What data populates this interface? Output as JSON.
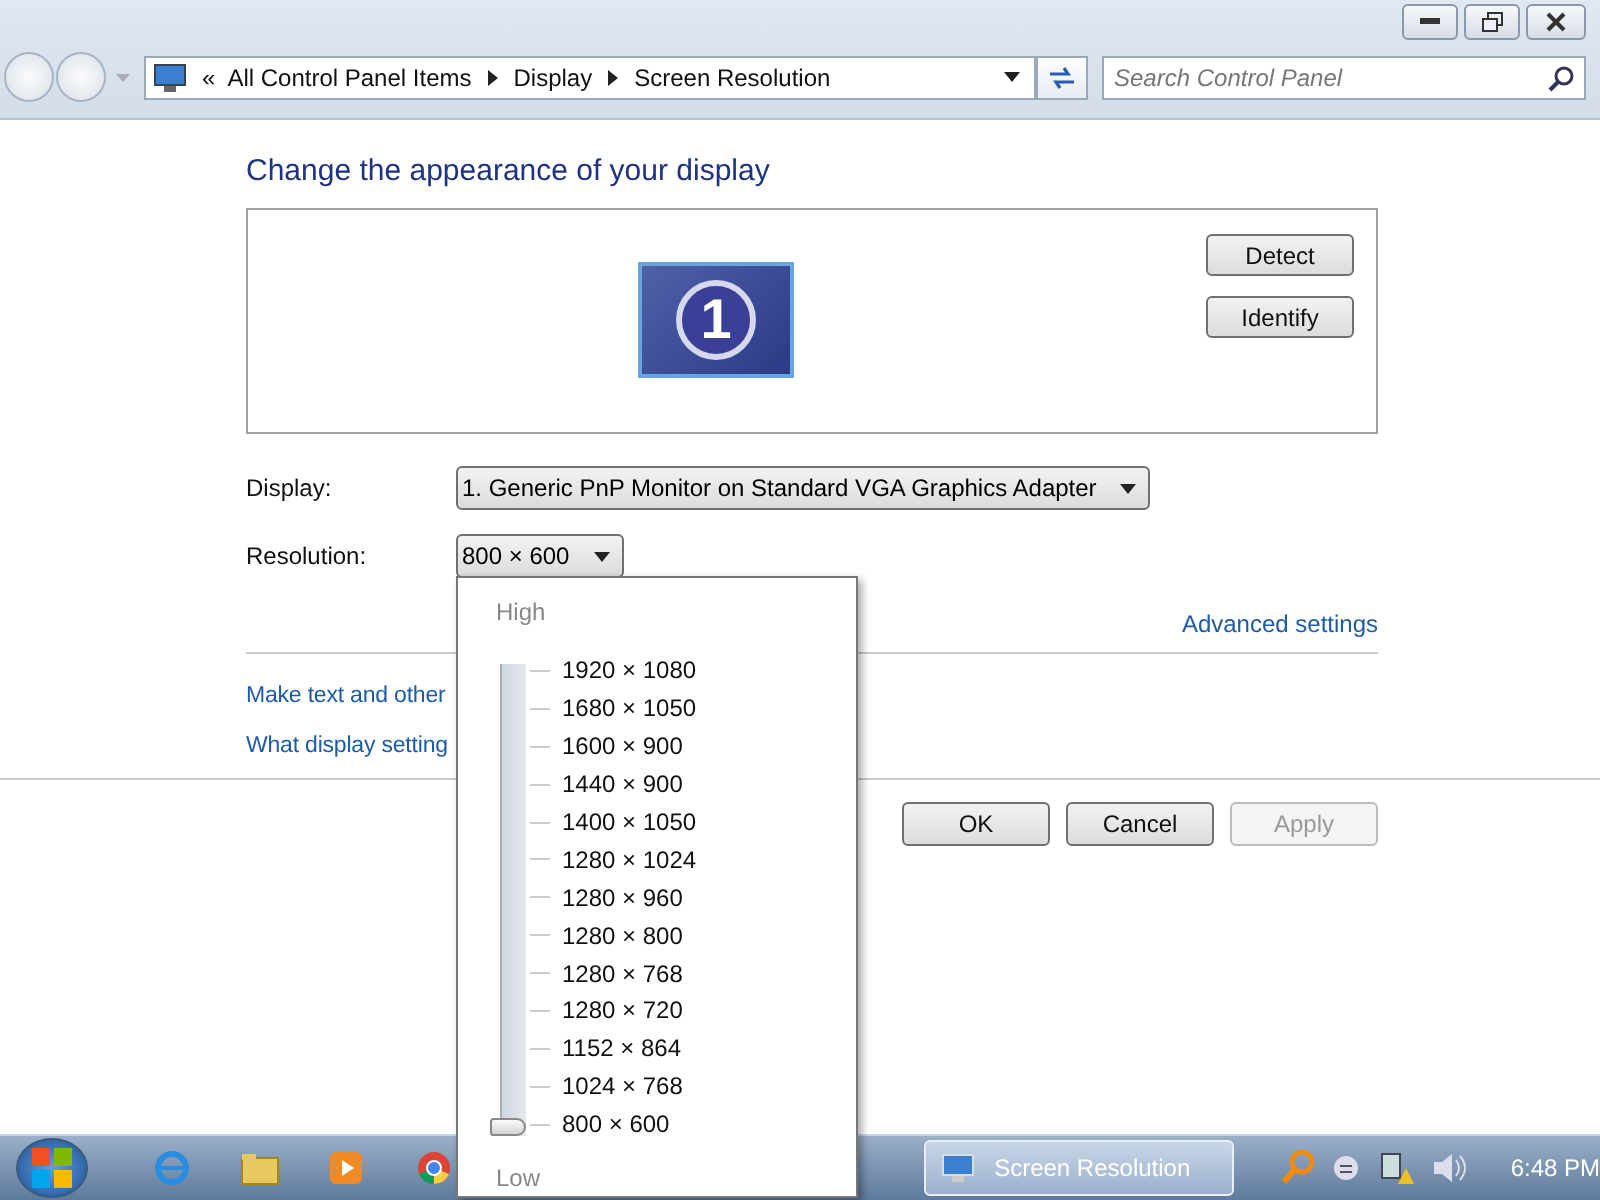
{
  "address_bar": {
    "overflow_chevron": "«",
    "breadcrumbs": [
      "All Control Panel Items",
      "Display",
      "Screen Resolution"
    ]
  },
  "search": {
    "placeholder": "Search Control Panel"
  },
  "heading": "Change the appearance of your display",
  "preview": {
    "monitor_number": "1",
    "buttons": [
      "Detect",
      "Identify"
    ]
  },
  "fields": [
    {
      "label": "Display:",
      "value": "1. Generic PnP Monitor on Standard VGA Graphics Adapter"
    },
    {
      "label": "Resolution:",
      "value": "800 × 600"
    }
  ],
  "advanced_link": "Advanced settings",
  "links": [
    "Make text and other",
    "What display setting"
  ],
  "buttons": [
    {
      "label": "OK",
      "disabled": false
    },
    {
      "label": "Cancel",
      "disabled": false
    },
    {
      "label": "Apply",
      "disabled": true
    }
  ],
  "resolution_popup": {
    "high_label": "High",
    "low_label": "Low",
    "level": 0,
    "options": [
      "1920 × 1080",
      "1680 × 1050",
      "1600 × 900",
      "1440 × 900",
      "1400 × 1050",
      "1280 × 1024",
      "1280 × 960",
      "1280 × 800",
      "1280 × 768",
      "1280 × 720",
      "1152 × 864",
      "1024 × 768",
      "800 × 600"
    ]
  },
  "taskbar": {
    "task": {
      "label": "Screen Resolution",
      "selected": true
    },
    "clock": "6:48 PM"
  }
}
